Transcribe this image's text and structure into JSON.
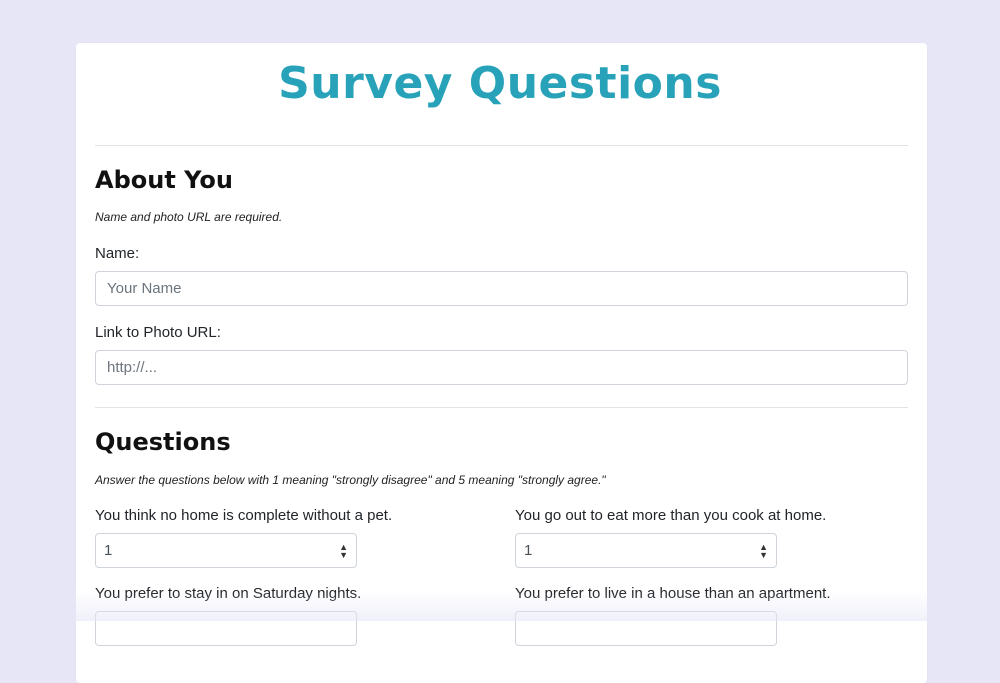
{
  "page": {
    "title": "Survey Questions"
  },
  "about": {
    "heading": "About You",
    "note": "Name and photo URL are required.",
    "name_label": "Name:",
    "name_placeholder": "Your Name",
    "photo_label": "Link to Photo URL:",
    "photo_placeholder": "http://..."
  },
  "questions": {
    "heading": "Questions",
    "note": "Answer the questions below with 1 meaning \"strongly disagree\" and 5 meaning \"strongly agree.\"",
    "items": [
      {
        "text": "You think no home is complete without a pet.",
        "value": "1"
      },
      {
        "text": "You go out to eat more than you cook at home.",
        "value": "1"
      },
      {
        "text": "You prefer to stay in on Saturday nights.",
        "value": ""
      },
      {
        "text": "You prefer to live in a house than an apartment.",
        "value": ""
      }
    ]
  },
  "colors": {
    "background": "#e6e6f7",
    "accent": "#27a2b8"
  }
}
